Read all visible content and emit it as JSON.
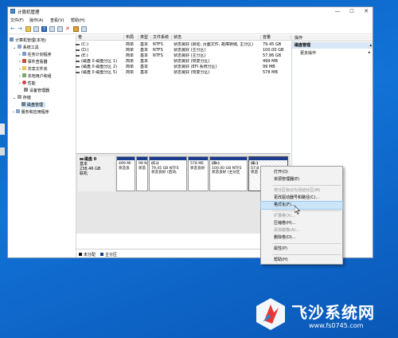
{
  "window": {
    "title": "计算机管理",
    "controls": [
      "—",
      "☐",
      "✕"
    ]
  },
  "menu": [
    "文件(F)",
    "操作(A)",
    "查看(V)",
    "帮助(H)"
  ],
  "tree": {
    "root": "计算机管理(本地)",
    "system_tools": "系统工具",
    "task_scheduler": "任务计划程序",
    "event_viewer": "事件查看器",
    "shared_folders": "共享文件夹",
    "local_users": "本地用户和组",
    "performance": "性能",
    "device_manager": "设备管理器",
    "storage": "存储",
    "disk_management": "磁盘管理",
    "services": "服务和应用程序"
  },
  "volumes": {
    "headers": [
      "卷",
      "布局",
      "类型",
      "文件系统",
      "状态",
      "容量"
    ],
    "rows": [
      [
        "(C:)",
        "简单",
        "基本",
        "NTFS",
        "状态良好 (启动, 页面文件, 故障转储, 主分区)",
        "79.45 GB"
      ],
      [
        "(D:)",
        "简单",
        "基本",
        "NTFS",
        "状态良好 (主分区)",
        "100.00 GB"
      ],
      [
        "(E:)",
        "简单",
        "基本",
        "NTFS",
        "状态良好 (主分区)",
        "57.86 GB"
      ],
      [
        "(磁盘 0 磁盘分区 1)",
        "简单",
        "基本",
        "",
        "状态良好 (恢复分区)",
        "499 MB"
      ],
      [
        "(磁盘 0 磁盘分区 2)",
        "简单",
        "基本",
        "",
        "状态良好 (EFI 系统分区)",
        "99 MB"
      ],
      [
        "(磁盘 0 磁盘分区 5)",
        "简单",
        "基本",
        "",
        "状态良好 (恢复分区)",
        "578 MB"
      ]
    ]
  },
  "disk": {
    "name": "磁盘 0",
    "type": "基本",
    "size": "238.46 GB",
    "status": "联机"
  },
  "partitions": [
    {
      "name": "",
      "l1": "499 MI",
      "l2": "状态良"
    },
    {
      "name": "",
      "l1": "99 N",
      "l2": "状态"
    },
    {
      "name": "(C:)",
      "l1": "79.45 GB NTFS",
      "l2": "状态良好 (启动,"
    },
    {
      "name": "",
      "l1": "578 ME",
      "l2": "状态良好"
    },
    {
      "name": "(D:)",
      "l1": "100.00 GB NTFS",
      "l2": "状态良好 (主分区"
    },
    {
      "name": "(E:)",
      "l1": "57.8",
      "l2": "状态"
    }
  ],
  "legend": {
    "unallocated": "未分配",
    "primary": "主分区"
  },
  "actions": {
    "header": "操作",
    "section": "磁盘管理",
    "more": "更多操作"
  },
  "context_menu": [
    {
      "label": "打开(O)",
      "enabled": true
    },
    {
      "label": "资源管理器(E)",
      "enabled": true
    },
    {
      "sep": true
    },
    {
      "label": "将分区标记为活动分区(M)",
      "enabled": false
    },
    {
      "label": "更改驱动器号和路径(C)...",
      "enabled": true
    },
    {
      "label": "格式化(F)...",
      "enabled": true,
      "highlight": true
    },
    {
      "sep": true
    },
    {
      "label": "扩展卷(X)...",
      "enabled": false
    },
    {
      "label": "压缩卷(H)...",
      "enabled": true
    },
    {
      "label": "添加镜像(A)...",
      "enabled": false
    },
    {
      "label": "删除卷(D)...",
      "enabled": true
    },
    {
      "sep": true
    },
    {
      "label": "属性(P)",
      "enabled": true
    },
    {
      "sep": true
    },
    {
      "label": "帮助(H)",
      "enabled": true
    }
  ],
  "watermark": {
    "title": "飞沙系统网",
    "url": "www.fs0745.com"
  },
  "colors": {
    "desktop": "#0b62c4",
    "primary_partition": "#1c3d8f",
    "highlight": "#cce4f7"
  }
}
